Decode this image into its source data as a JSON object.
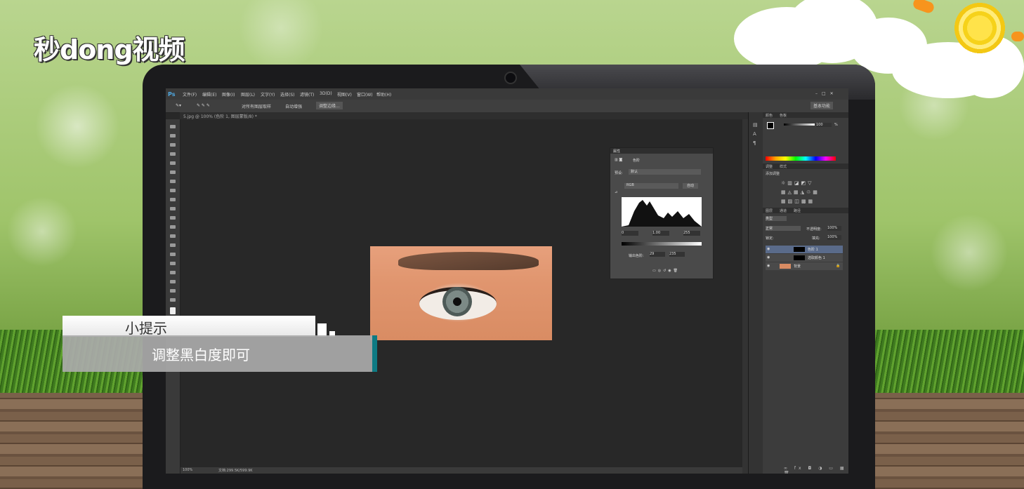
{
  "brand": {
    "logo_text": "秒dong视频"
  },
  "photoshop": {
    "app_logo": "Ps",
    "menu": [
      "文件(F)",
      "编辑(E)",
      "图像(I)",
      "图层(L)",
      "文字(Y)",
      "选择(S)",
      "滤镜(T)",
      "3D(D)",
      "视图(V)",
      "窗口(W)",
      "帮助(H)"
    ],
    "options": {
      "sample_all_layers": "对所有图层取样",
      "auto_enhance": "自动增强",
      "refine_edge": "调整边缘...",
      "workspace": "基本功能"
    },
    "document_tab": "5.jpg @ 100% (色阶 1, 图层蒙版/8) *",
    "status": {
      "zoom": "100%",
      "doc_size": "文档:299.5K/599.9K"
    },
    "properties_panel": {
      "title": "属性",
      "section": "色阶",
      "preset_label": "预设:",
      "preset_value": "默认",
      "channel": "RGB",
      "auto_button": "自动",
      "input_values": [
        "0",
        "1.00",
        "255"
      ],
      "output_label": "输出色阶:",
      "output_values": [
        "29",
        "235"
      ]
    },
    "color_panel": {
      "tabs": [
        "颜色",
        "色板"
      ],
      "value": "100",
      "unit": "%"
    },
    "adjustments_panel": {
      "tabs": [
        "调整",
        "样式"
      ],
      "add_label": "添加调整"
    },
    "layers_panel": {
      "tabs": [
        "图层",
        "通道",
        "路径"
      ],
      "kind": "类型",
      "blend_mode": "正常",
      "opacity_label": "不透明度:",
      "opacity": "100%",
      "lock_label": "锁定:",
      "fill_label": "填充:",
      "fill": "100%",
      "layers": [
        {
          "name": "色阶 1",
          "selected": true
        },
        {
          "name": "选取颜色 1",
          "selected": false
        },
        {
          "name": "背景",
          "selected": false
        }
      ]
    }
  },
  "tip": {
    "label": "小提示",
    "text": "调整黑白度即可",
    "accent_color": "#0e7a83"
  }
}
